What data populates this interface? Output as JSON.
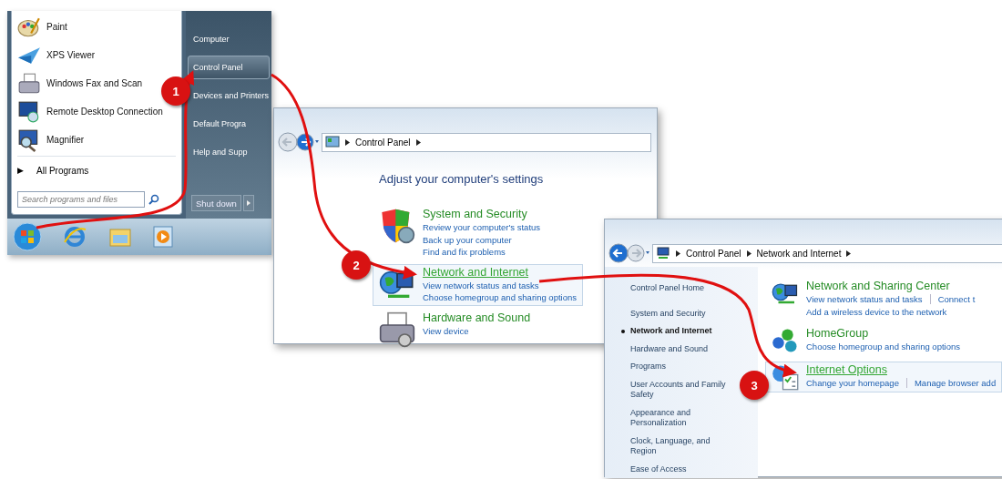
{
  "start_menu": {
    "programs": [
      {
        "label": "Paint",
        "kind": "paint"
      },
      {
        "label": "XPS Viewer",
        "kind": "xps"
      },
      {
        "label": "Windows Fax and Scan",
        "kind": "fax"
      },
      {
        "label": "Remote Desktop Connection",
        "kind": "remote"
      },
      {
        "label": "Magnifier",
        "kind": "magnifier"
      }
    ],
    "all_programs": {
      "arrow": "▶",
      "label": "All Programs"
    },
    "search": {
      "placeholder": "Search programs and files"
    },
    "places": [
      {
        "label": "Computer",
        "selected": false
      },
      {
        "label": "Control Panel",
        "selected": true
      },
      {
        "label": "Devices and Printers",
        "selected": false
      },
      {
        "label": "Default Progra",
        "selected": false
      },
      {
        "label": "Help and Supp",
        "selected": false
      }
    ],
    "shutdown": "Shut down"
  },
  "control_panel": {
    "breadcrumb": [
      "Control Panel"
    ],
    "heading": "Adjust your computer's settings",
    "categories": [
      {
        "title": "System and Security",
        "kind": "shield",
        "selected": false,
        "links": [
          "Review your computer's status",
          "Back up your computer",
          "Find and fix problems"
        ]
      },
      {
        "title": "Network and Internet",
        "kind": "network",
        "selected": true,
        "links": [
          "View network status and tasks",
          "Choose homegroup and sharing options"
        ]
      },
      {
        "title": "Hardware and Sound",
        "kind": "printer",
        "selected": false,
        "links": [
          "View device"
        ]
      }
    ]
  },
  "network_window": {
    "breadcrumb": [
      "Control Panel",
      "Network and Internet"
    ],
    "sidebar": [
      {
        "label": "Control Panel Home",
        "selected": false
      },
      {
        "label": "System and Security",
        "selected": false
      },
      {
        "label": "Network and Internet",
        "selected": true
      },
      {
        "label": "Hardware and Sound",
        "selected": false
      },
      {
        "label": "Programs",
        "selected": false
      },
      {
        "label": "User Accounts and Family Safety",
        "selected": false
      },
      {
        "label": "Appearance and Personalization",
        "selected": false
      },
      {
        "label": "Clock, Language, and Region",
        "selected": false
      },
      {
        "label": "Ease of Access",
        "selected": false
      }
    ],
    "categories": [
      {
        "title": "Network and Sharing Center",
        "kind": "network",
        "selected": false,
        "links": [
          "View network status and tasks",
          "Connect t"
        ],
        "more_links": [
          "Add a wireless device to the network"
        ]
      },
      {
        "title": "HomeGroup",
        "kind": "homegroup",
        "selected": false,
        "links": [
          "Choose homegroup and sharing options"
        ]
      },
      {
        "title": "Internet Options",
        "kind": "options",
        "selected": true,
        "links": [
          "Change your homepage",
          "Manage browser add"
        ]
      }
    ]
  },
  "steps": [
    "1",
    "2",
    "3"
  ]
}
